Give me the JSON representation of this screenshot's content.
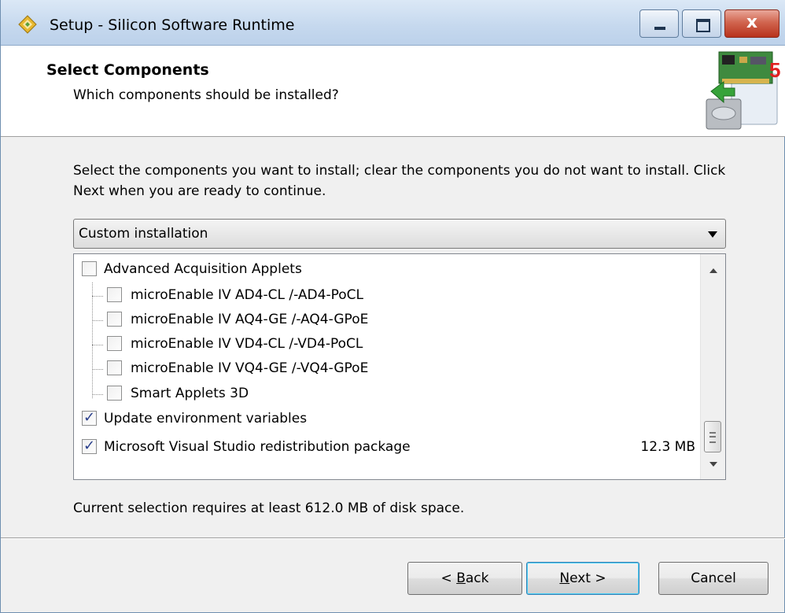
{
  "window": {
    "title": "Setup - Silicon Software Runtime",
    "close_glyph": "x"
  },
  "header": {
    "title": "Select Components",
    "subtitle": "Which components should be installed?"
  },
  "body": {
    "intro": "Select the components you want to install; clear the components you do not want to install. Click Next when you are ready to continue.",
    "install_type": "Custom installation",
    "components": [
      {
        "label": "Advanced Acquisition Applets",
        "checked": false,
        "level": 0
      },
      {
        "label": "microEnable IV AD4-CL /-AD4-PoCL",
        "checked": false,
        "level": 1
      },
      {
        "label": "microEnable IV AQ4-GE /-AQ4-GPoE",
        "checked": false,
        "level": 1
      },
      {
        "label": "microEnable IV VD4-CL /-VD4-PoCL",
        "checked": false,
        "level": 1
      },
      {
        "label": "microEnable IV VQ4-GE /-VQ4-GPoE",
        "checked": false,
        "level": 1
      },
      {
        "label": "Smart Applets 3D",
        "checked": false,
        "level": 1
      },
      {
        "label": "Update environment variables",
        "checked": true,
        "level": 0
      },
      {
        "label": "Microsoft Visual Studio redistribution package",
        "checked": true,
        "level": 0,
        "size": "12.3 MB"
      }
    ],
    "disk_space": "Current selection requires at least 612.0 MB of disk space."
  },
  "buttons": {
    "back": {
      "underlined": "B",
      "before": "< ",
      "after": "ack"
    },
    "next": {
      "underlined": "N",
      "before": "",
      "after": "ext >"
    },
    "cancel": "Cancel"
  }
}
